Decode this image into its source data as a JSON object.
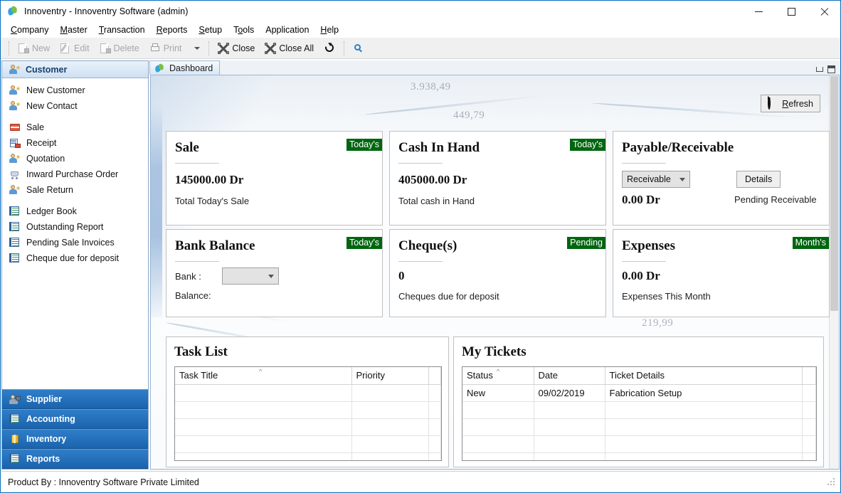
{
  "window": {
    "title": "Innoventry - Innoventry Software (admin)",
    "app_icon": "innoventry-logo-icon",
    "minimize": "—",
    "maximize": "□",
    "close": "✕"
  },
  "menubar": [
    {
      "label": "Company",
      "accel": "C"
    },
    {
      "label": "Master",
      "accel": "M"
    },
    {
      "label": "Transaction",
      "accel": "T"
    },
    {
      "label": "Reports",
      "accel": "R"
    },
    {
      "label": "Setup",
      "accel": "S"
    },
    {
      "label": "Tools",
      "accel": "o"
    },
    {
      "label": "Application",
      "accel": ""
    },
    {
      "label": "Help",
      "accel": "H"
    }
  ],
  "toolbar": {
    "new_label": "New",
    "edit_label": "Edit",
    "delete_label": "Delete",
    "print_label": "Print",
    "close_label": "Close",
    "close_all_label": "Close All",
    "refresh_icon": "refresh-icon",
    "search_icon": "search-icon"
  },
  "sidebar": {
    "header": {
      "label": "Customer",
      "icon": "customer-icon"
    },
    "group_one": [
      {
        "label": "New Customer",
        "icon": "customer-icon"
      },
      {
        "label": "New Contact",
        "icon": "customer-icon"
      }
    ],
    "group_two": [
      {
        "label": "Sale",
        "icon": "sale-icon"
      },
      {
        "label": "Receipt",
        "icon": "receipt-icon"
      },
      {
        "label": "Quotation",
        "icon": "customer-icon"
      },
      {
        "label": "Inward Purchase Order",
        "icon": "cart-icon"
      },
      {
        "label": "Sale Return",
        "icon": "customer-icon"
      }
    ],
    "group_three": [
      {
        "label": "Ledger Book",
        "icon": "ledger-icon"
      },
      {
        "label": "Outstanding Report",
        "icon": "ledger-icon"
      },
      {
        "label": "Pending Sale Invoices",
        "icon": "ledger-icon"
      },
      {
        "label": "Cheque due for deposit",
        "icon": "ledger-icon"
      }
    ],
    "buttons": [
      {
        "label": "Supplier",
        "icon": "supplier-icon"
      },
      {
        "label": "Accounting",
        "icon": "ledger-icon"
      },
      {
        "label": "Inventory",
        "icon": "inventory-icon"
      },
      {
        "label": "Reports",
        "icon": "ledger-icon"
      }
    ]
  },
  "mdi": {
    "tab": {
      "label": "Dashboard",
      "icon": "innoventry-logo-icon"
    },
    "minimize": "minimize-icon",
    "restore": "restore-icon"
  },
  "dashboard": {
    "refresh_label": "Refresh",
    "refresh_accel": "R",
    "watermark": [
      "3.938,49",
      "449,79",
      "219,99"
    ],
    "cards": [
      {
        "name": "sale",
        "title": "Sale",
        "badge": "Today's",
        "value": "145000.00 Dr",
        "subtitle": "Total Today's Sale"
      },
      {
        "name": "cash-in-hand",
        "title": "Cash In Hand",
        "badge": "Today's",
        "value": "405000.00 Dr",
        "subtitle": "Total cash in Hand"
      },
      {
        "name": "payable-receivable",
        "title": "Payable/Receivable",
        "badge": "",
        "select_value": "Receivable",
        "details_label": "Details",
        "value": "0.00 Dr",
        "subtitle": "Pending Receivable"
      },
      {
        "name": "bank-balance",
        "title": "Bank Balance",
        "badge": "Today's",
        "bank_label": "Bank :",
        "bank_value": "",
        "balance_label": "Balance:",
        "balance_value": ""
      },
      {
        "name": "cheques",
        "title": "Cheque(s)",
        "badge": "Pending",
        "value": "0",
        "subtitle": "Cheques due for deposit"
      },
      {
        "name": "expenses",
        "title": "Expenses",
        "badge": "Month's",
        "value": "0.00 Dr",
        "subtitle": "Expenses This Month"
      }
    ],
    "task_list": {
      "title": "Task List",
      "columns": [
        "Task Title",
        "Priority",
        ""
      ],
      "sorted_column": "Task Title",
      "rows": [],
      "empty_row_count": 6
    },
    "my_tickets": {
      "title": "My Tickets",
      "columns": [
        "Status",
        "Date",
        "Ticket Details",
        ""
      ],
      "sorted_column": "Status",
      "rows": [
        {
          "status": "New",
          "date": "09/02/2019",
          "details": "Fabrication Setup",
          "extra": ""
        }
      ],
      "empty_row_count": 5
    }
  },
  "statusbar": {
    "text": "Product By : Innoventry Software Private Limited"
  },
  "colors": {
    "accent_blue": "#1b63ad",
    "badge_green": "#00650f",
    "title_border": "#0a6ebd"
  }
}
